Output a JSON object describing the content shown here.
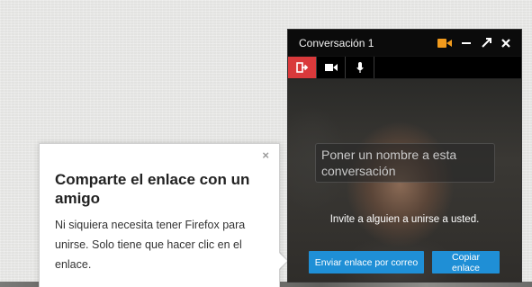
{
  "conversation": {
    "title": "Conversación 1",
    "icons": {
      "camera": "video-camera-icon",
      "minimize": "minimize-icon",
      "expand": "expand-icon",
      "close": "close-icon"
    },
    "toolbar": {
      "buttons": [
        {
          "name": "hangup-icon",
          "active": true
        },
        {
          "name": "video-camera-icon",
          "active": false
        },
        {
          "name": "microphone-icon",
          "active": false
        }
      ]
    },
    "name_placeholder": "Poner un nombre a esta conversación",
    "invite_text": "Invite a alguien a unirse a usted.",
    "email_button": "Enviar enlace por correo",
    "copy_button": "Copiar enlace",
    "colors": {
      "accent_orange": "#f29b1d",
      "active_red": "#d9393b",
      "button_blue": "#1f8fd6"
    }
  },
  "share_panel": {
    "close_glyph": "×",
    "heading": "Comparte el enlace con un amigo",
    "body": "Ni siquiera necesita tener Firefox para unirse. Solo tiene que hacer clic en el enlace."
  }
}
